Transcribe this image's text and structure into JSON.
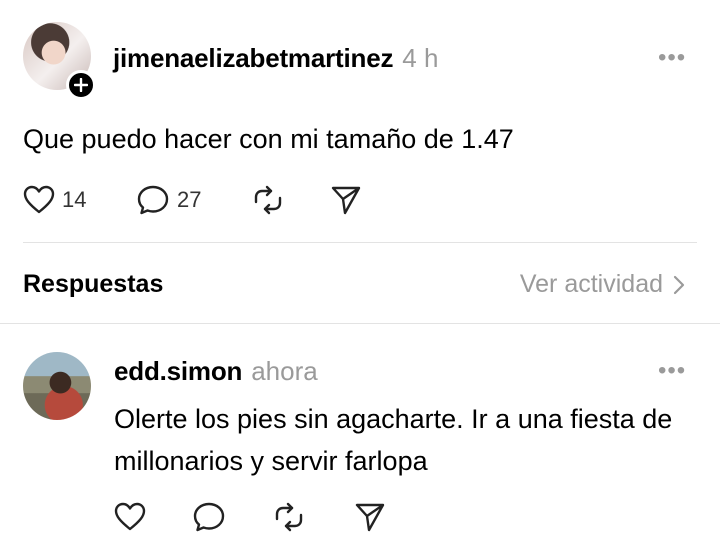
{
  "post": {
    "username": "jimenaelizabetmartinez",
    "time": "4 h",
    "text": "Que puedo hacer con mi tamaño de 1.47",
    "likes": "14",
    "comments": "27",
    "more_icon": "more-dots-icon"
  },
  "replies_header": {
    "title": "Respuestas",
    "activity_label": "Ver actividad"
  },
  "reply": {
    "username": "edd.simon",
    "time": "ahora",
    "text": "Olerte los pies sin agacharte. Ir a una fiesta de millonarios y servir farlopa"
  }
}
